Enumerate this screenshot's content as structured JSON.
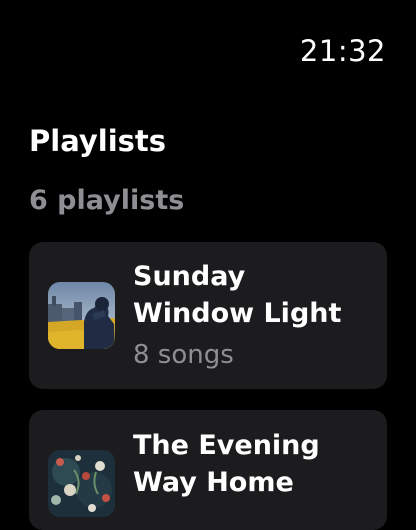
{
  "status": {
    "time": "21:32"
  },
  "header": {
    "title": "Playlists",
    "count_label": "6 playlists"
  },
  "playlists": [
    {
      "title": "Sunday Window Light",
      "subtitle": "8 songs",
      "artwork": "city-silhouette-artwork"
    },
    {
      "title": "The Evening Way Home",
      "subtitle": "",
      "artwork": "floral-dark-artwork"
    }
  ],
  "colors": {
    "background": "#000000",
    "card": "#1c1c1e",
    "secondary_text": "#8e8e93"
  }
}
